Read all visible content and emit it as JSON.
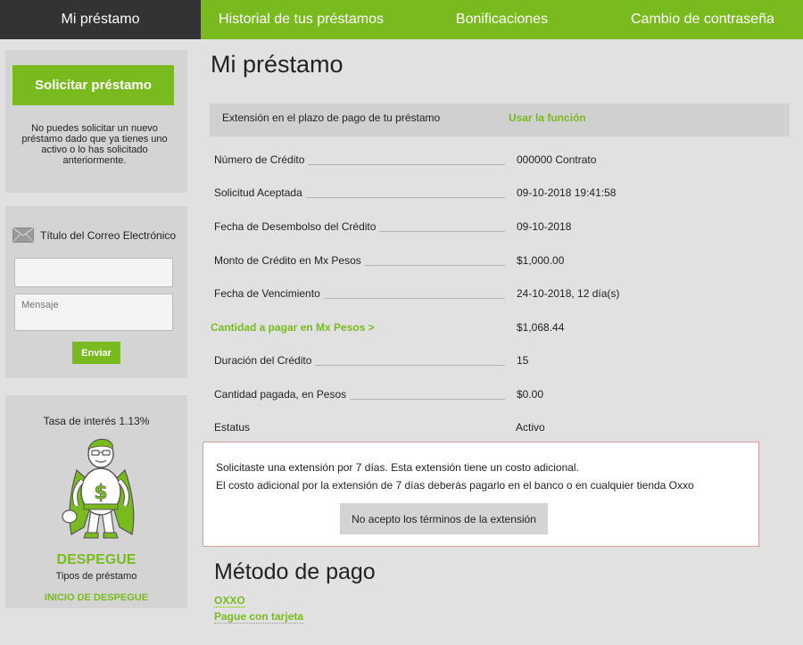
{
  "nav": {
    "tabs": [
      {
        "label": "Mi préstamo",
        "active": true
      },
      {
        "label": "Historial de tus préstamos",
        "active": false
      },
      {
        "label": "Bonificaciones",
        "active": false
      },
      {
        "label": "Cambio de contraseña",
        "active": false
      }
    ]
  },
  "sidebar": {
    "request_button": "Solicitar préstamo",
    "request_note": "No puedes solicitar un nuevo préstamo dado que ya tienes uno activo o lo has solicitado anteriormente.",
    "contact": {
      "label": "Título del Correo Electrónico",
      "email_value": "",
      "message_placeholder": "Mensaje",
      "send_button": "Enviar"
    },
    "promo": {
      "rate": "Tasa de interés 1.13%",
      "brand": "DESPEGUE",
      "types": "Tipos de préstamo",
      "link": "INICIO DE DESPEGUE"
    }
  },
  "main": {
    "title": "Mi préstamo",
    "extension": {
      "label": "Extensión en el plazo de pago de tu préstamo",
      "action": "Usar la función"
    },
    "rows": [
      {
        "key": "Número de Crédito",
        "value": "000000 Contrato"
      },
      {
        "key": "Solicitud Aceptada",
        "value": "09-10-2018 19:41:58"
      },
      {
        "key": "Fecha de Desembolso del Crédito",
        "value": "09-10-2018"
      },
      {
        "key": "Monto de Crédito en Mx Pesos",
        "value": "$1,000.00"
      },
      {
        "key": "Fecha de Vencimiento",
        "value": "24-10-2018, 12 día(s)"
      },
      {
        "key": "Cantidad a pagar en Mx Pesos >",
        "value": "$1,068.44"
      },
      {
        "key": "Duración del Crédito",
        "value": "15"
      },
      {
        "key": "Cantidad pagada, en Pesos",
        "value": "$0.00"
      },
      {
        "key": "Estatus",
        "value": "Activo"
      }
    ],
    "notice": {
      "line1": "Solicitaste una extensión por 7 días. Esta extensión tiene un costo adicional.",
      "line2": "El costo adicional por la extensión de 7 días deberás pagarlo en el banco o en cualquier tienda Oxxo",
      "button": "No acepto los términos de la extensión"
    },
    "payment": {
      "title": "Método de pago",
      "methods": [
        "OXXO",
        "Pague con tarjeta"
      ]
    }
  },
  "colors": {
    "accent": "#79bb1f",
    "nav_active": "#333333",
    "background": "#e1e1e1",
    "panel": "#d4d4d4"
  }
}
